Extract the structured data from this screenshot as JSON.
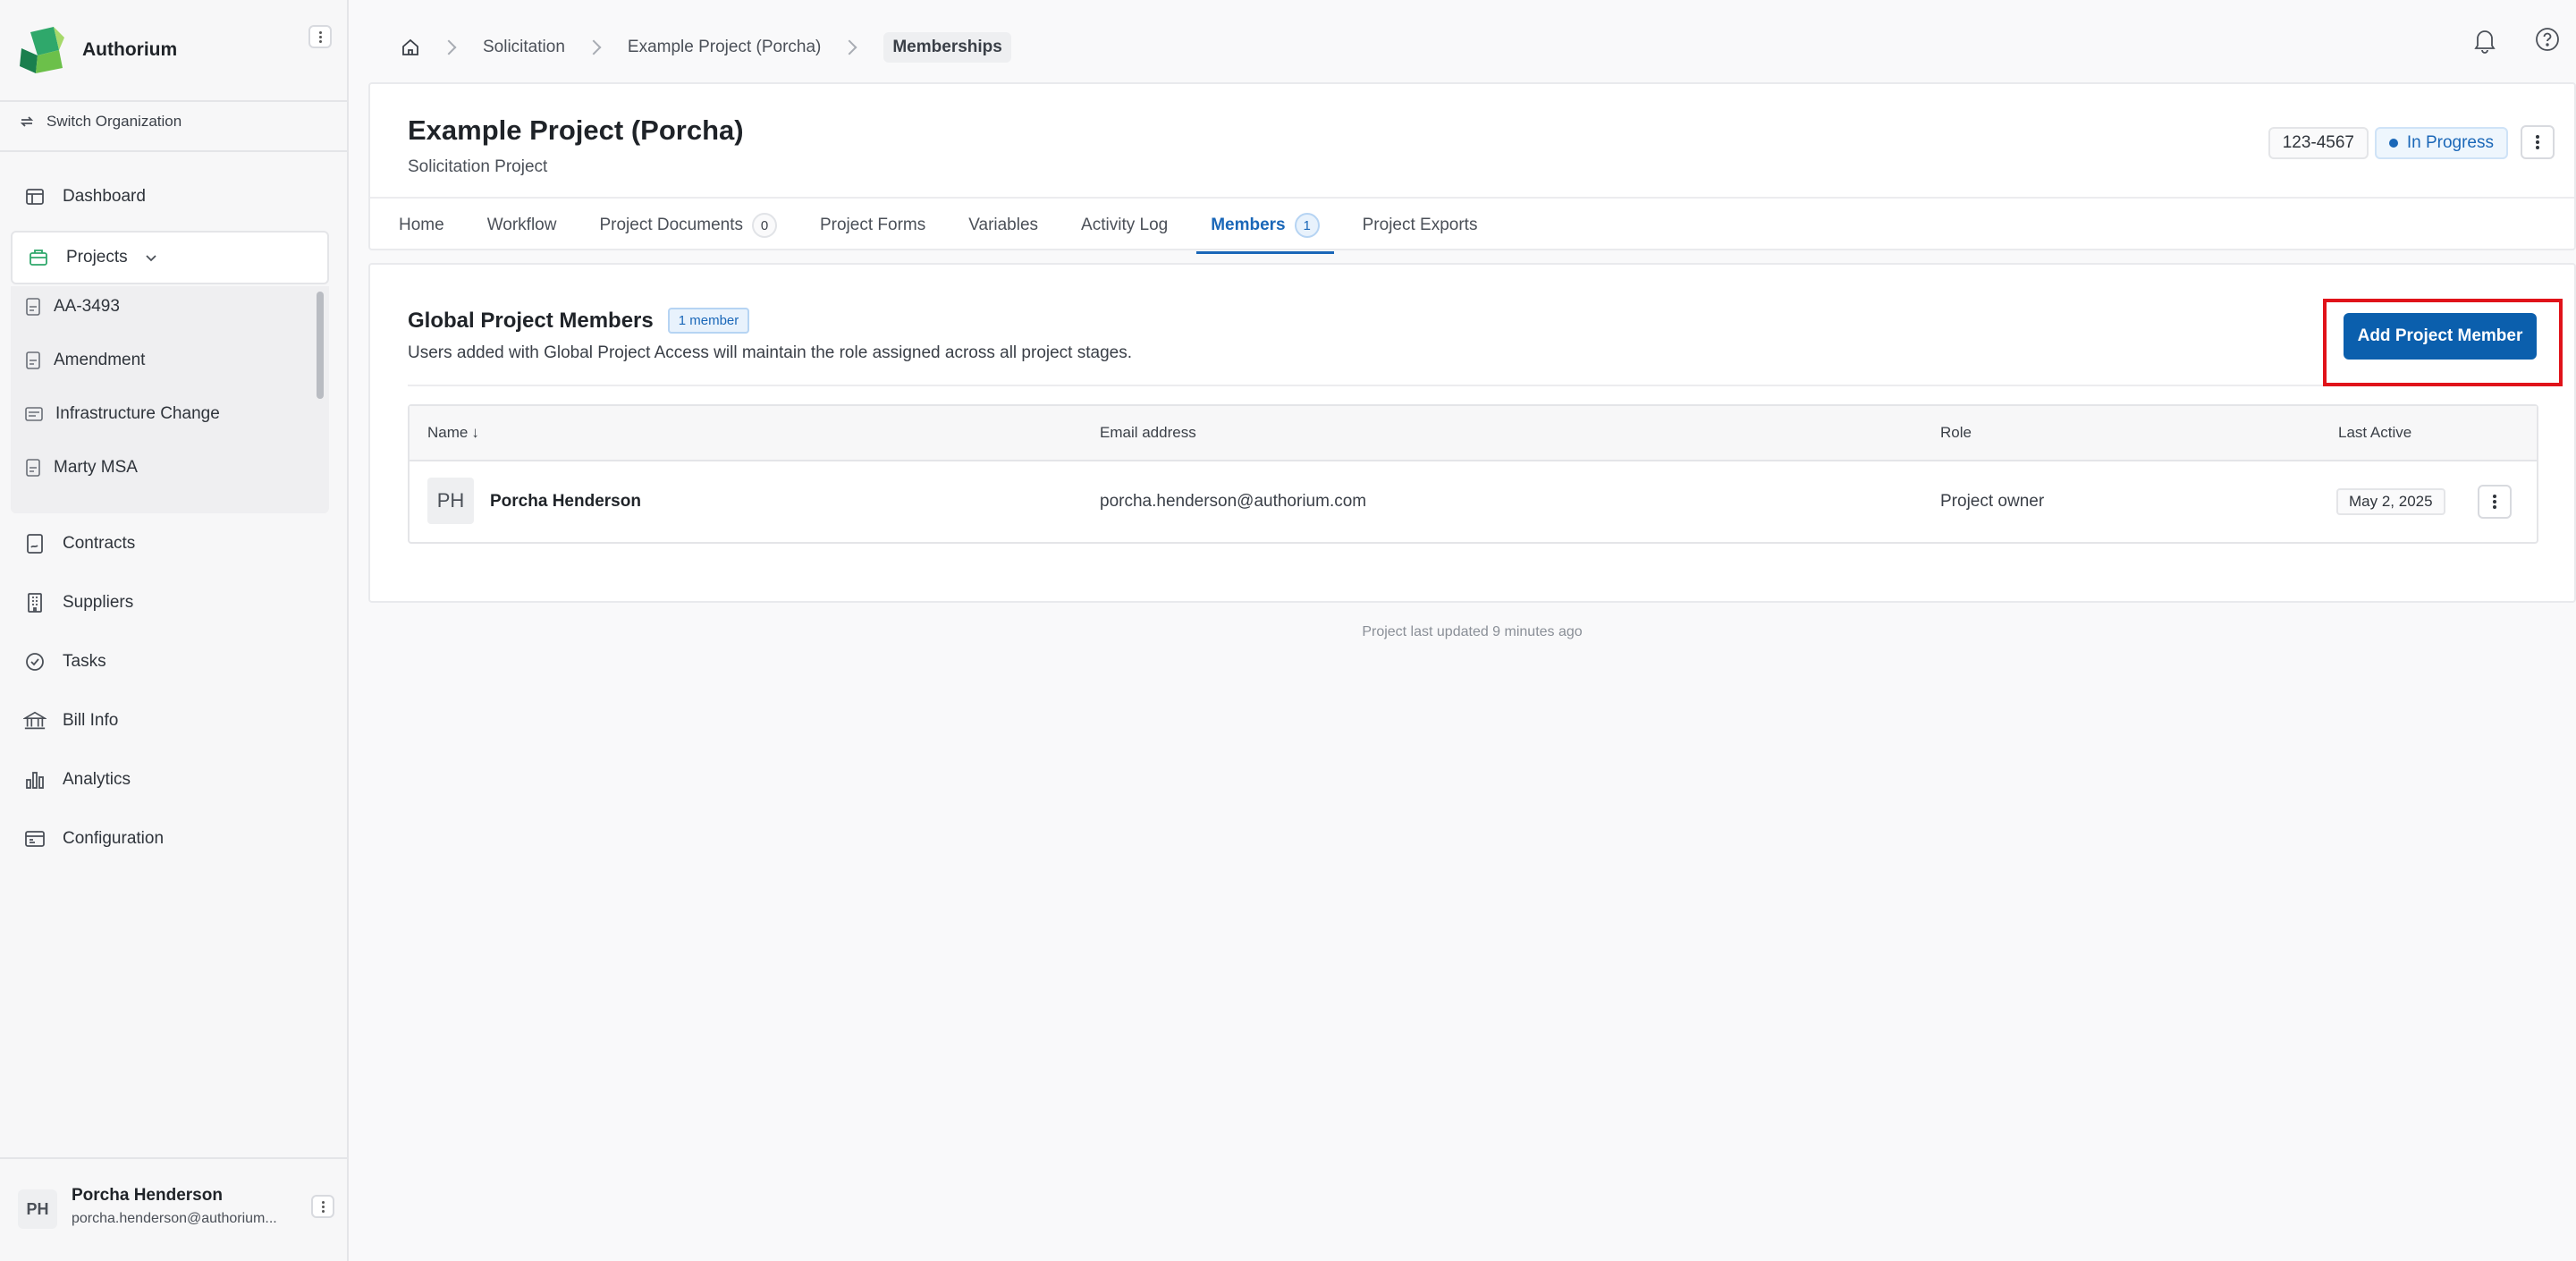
{
  "sidebar": {
    "brand": "Authorium",
    "switch_org": "Switch Organization",
    "nav": {
      "dashboard": "Dashboard",
      "projects": "Projects",
      "contracts": "Contracts",
      "suppliers": "Suppliers",
      "tasks": "Tasks",
      "bill_info": "Bill Info",
      "analytics": "Analytics",
      "configuration": "Configuration"
    },
    "projects_sub": [
      "AA-3493",
      "Amendment",
      "Infrastructure Change",
      "Marty MSA"
    ],
    "user": {
      "initials": "PH",
      "name": "Porcha Henderson",
      "email": "porcha.henderson@authorium..."
    }
  },
  "breadcrumb": {
    "items": [
      "Solicitation",
      "Example Project (Porcha)"
    ],
    "current": "Memberships"
  },
  "project": {
    "title": "Example Project (Porcha)",
    "subtitle": "Solicitation Project",
    "id": "123-4567",
    "status": "In Progress",
    "status_color": "#1a67b8"
  },
  "tabs": [
    {
      "label": "Home"
    },
    {
      "label": "Workflow"
    },
    {
      "label": "Project Documents",
      "count": "0"
    },
    {
      "label": "Project Forms"
    },
    {
      "label": "Variables"
    },
    {
      "label": "Activity Log"
    },
    {
      "label": "Members",
      "count": "1",
      "active": true
    },
    {
      "label": "Project Exports"
    }
  ],
  "members_section": {
    "title": "Global Project Members",
    "badge": "1 member",
    "description": "Users added with Global Project Access will maintain the role assigned across all project stages.",
    "add_button": "Add Project Member",
    "highlight_color": "#e0131a"
  },
  "table": {
    "headers": {
      "name": "Name",
      "email": "Email address",
      "role": "Role",
      "last_active": "Last Active"
    },
    "sort_indicator": "↓",
    "rows": [
      {
        "initials": "PH",
        "name": "Porcha Henderson",
        "email": "porcha.henderson@authorium.com",
        "role": "Project owner",
        "last_active": "May 2, 2025"
      }
    ]
  },
  "footer": "Project last updated 9 minutes ago",
  "accent_color": "#0b5fad"
}
